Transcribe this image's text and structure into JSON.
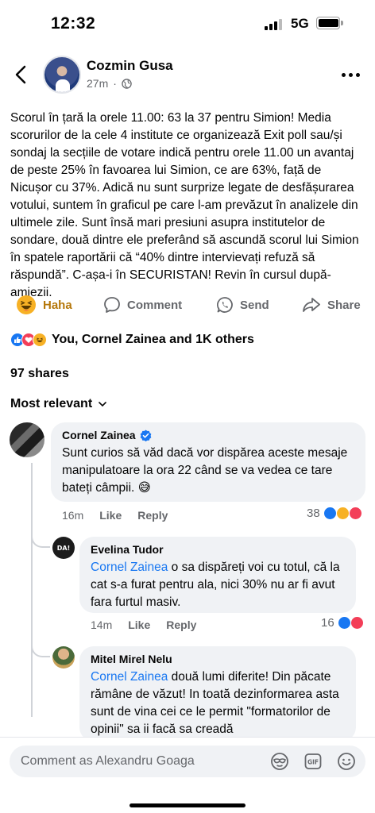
{
  "status_bar": {
    "time": "12:32",
    "network": "5G"
  },
  "post": {
    "author": "Cozmin Gusa",
    "time_ago": "27m",
    "text": "Scorul în țară la orele 11.00: 63 la 37 pentru Simion! Media scorurilor de la cele 4 institute ce organizează Exit poll sau/și sondaj la secțiile de votare indică pentru orele 11.00 un avantaj de peste 25% în favoarea lui Simion, ce are 63%, față de Nicușor cu 37%. Adică nu sunt surprize legate de desfășurarea votului, suntem în graficul pe care l-am prevăzut în analizele din ultimele zile. Sunt însă mari presiuni asupra institutelor de sondare, două dintre ele preferând să ascundă scorul lui Simion în spatele raportării că “40% dintre intervievați refuză să răspundă”. C-așa-i în SECURISTAN! Revin în cursul după-amiezii.",
    "actions": {
      "haha": "Haha",
      "comment": "Comment",
      "send": "Send",
      "share": "Share"
    },
    "reactions_text": "You, Cornel Zainea and 1K others",
    "shares": "97 shares",
    "sort": "Most relevant"
  },
  "comments": [
    {
      "name": "Cornel Zainea",
      "text": "Sunt curios să văd dacă vor dispărea aceste mesaje manipulatoare la ora 22 când se va vedea ce tare bateți câmpii. 😅",
      "time": "16m",
      "like": "Like",
      "reply": "Reply",
      "count": "38"
    },
    {
      "name": "Evelina Tudor",
      "mention": "Cornel Zainea",
      "text": " o sa dispăreți voi cu totul, că la cat s-a furat pentru ala, nici 30% nu ar fi avut fara furtul masiv.",
      "time": "14m",
      "like": "Like",
      "reply": "Reply",
      "count": "16"
    },
    {
      "name": "Mitel Mirel Nelu",
      "mention": "Cornel Zainea",
      "text": " două lumi diferite! Din păcate rămâne de văzut! In toată dezinformarea asta sunt de vina cei ce le permit \"formatorilor de opinii\" sa ii facă sa creadă"
    }
  ],
  "comment_input": {
    "placeholder": "Comment as Alexandru Goaga"
  },
  "icons": [
    "back-arrow-icon",
    "globe-icon",
    "more-dots-icon",
    "haha-icon",
    "comment-icon",
    "whatsapp-icon",
    "share-icon",
    "like-reaction-icon",
    "love-reaction-icon",
    "haha-reaction-icon",
    "verified-badge-icon",
    "chevron-down-icon",
    "avatar-frame-icon",
    "gif-icon",
    "emoji-icon"
  ],
  "colors": {
    "accent": "#1877f2",
    "meta": "#65676b",
    "bubble": "#f0f2f5",
    "love": "#f33e58",
    "haha": "#f7b125"
  }
}
